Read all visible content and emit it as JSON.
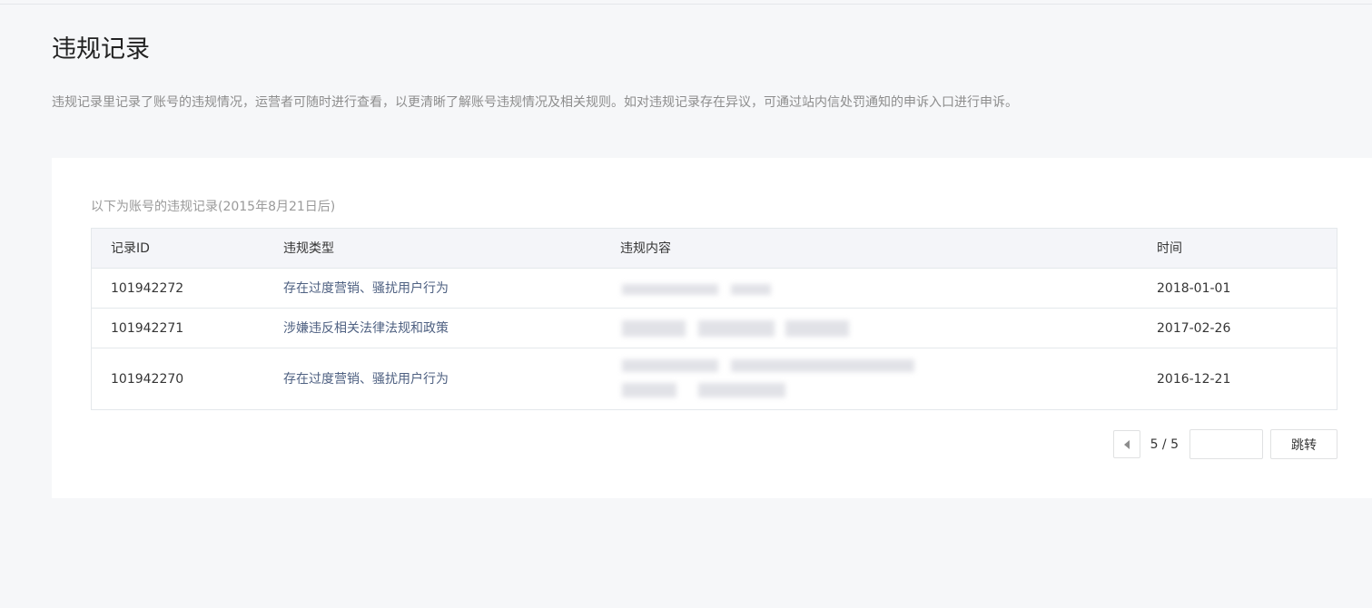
{
  "page": {
    "title": "违规记录",
    "description": "违规记录里记录了账号的违规情况，运营者可随时进行查看，以更清晰了解账号违规情况及相关规则。如对违规记录存在异议，可通过站内信处罚通知的申诉入口进行申诉。"
  },
  "records": {
    "caption": "以下为账号的违规记录(2015年8月21日后)",
    "columns": [
      "记录ID",
      "违规类型",
      "违规内容",
      "时间"
    ],
    "rows": [
      {
        "id": "101942272",
        "type": "存在过度营销、骚扰用户行为",
        "date": "2018-01-01"
      },
      {
        "id": "101942271",
        "type": "涉嫌违反相关法律法规和政策",
        "date": "2017-02-26"
      },
      {
        "id": "101942270",
        "type": "存在过度营销、骚扰用户行为",
        "date": "2016-12-21"
      }
    ]
  },
  "pagination": {
    "page_display": "5 / 5",
    "jump_input_value": "",
    "jump_button_label": "跳转",
    "prev_icon": "caret-left-icon"
  },
  "colors": {
    "background": "#f6f7f9",
    "card": "#ffffff",
    "header_row": "#f4f5f9",
    "type_text": "#4f6182",
    "muted_text": "#8d8d8d"
  }
}
